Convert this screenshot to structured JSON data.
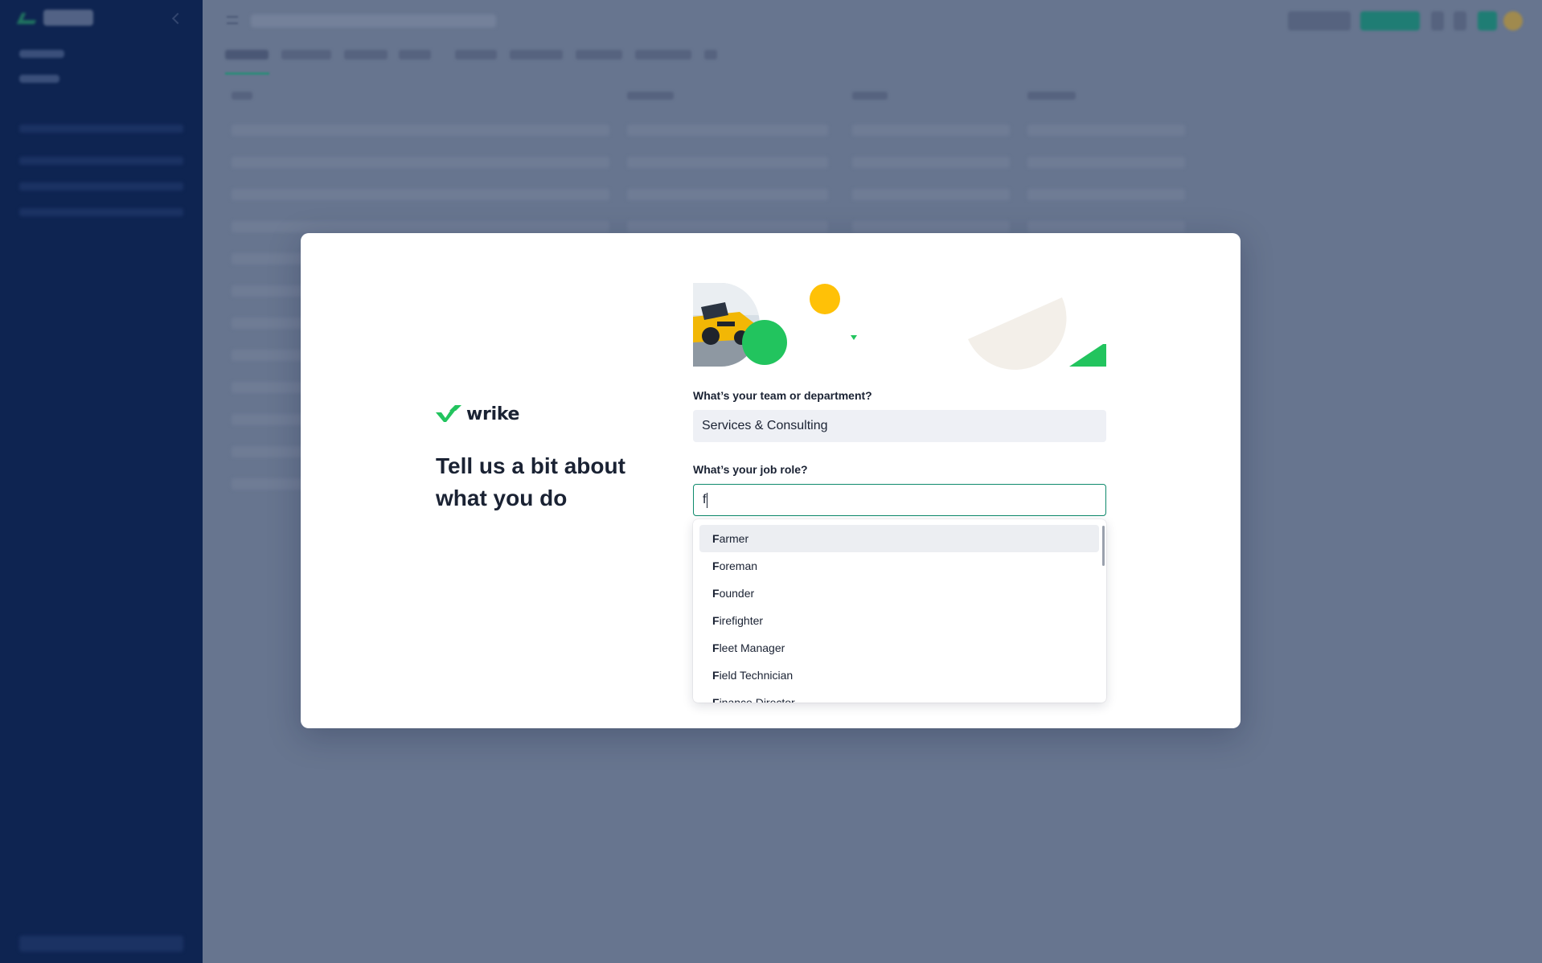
{
  "modal": {
    "brand": {
      "name": "wrike"
    },
    "headline": "Tell us a bit about what you do",
    "team_field": {
      "label": "What’s your team or department?",
      "value": "Services & Consulting"
    },
    "role_field": {
      "label": "What’s your job role?",
      "typed_value": "f"
    },
    "role_suggestions": [
      {
        "match": "F",
        "rest": "armer"
      },
      {
        "match": "F",
        "rest": "oreman"
      },
      {
        "match": "F",
        "rest": "ounder"
      },
      {
        "match": "F",
        "rest": "irefighter"
      },
      {
        "match": "F",
        "rest": "leet Manager"
      },
      {
        "match": "F",
        "rest": "ield Technician"
      },
      {
        "match": "F",
        "rest": "inance Director"
      }
    ],
    "illustration": {
      "icons": [
        "race-car-photo",
        "green-circle",
        "yellow-circle",
        "small-green-triangle",
        "beige-half-circle",
        "green-triangle"
      ]
    }
  },
  "colors": {
    "brand_green": "#22c45e",
    "accent_teal": "#0e8a6c",
    "sidebar_navy": "#0e2451",
    "overlay": "#67758f",
    "yellow": "#ffc107",
    "beige": "#f3efe9"
  }
}
